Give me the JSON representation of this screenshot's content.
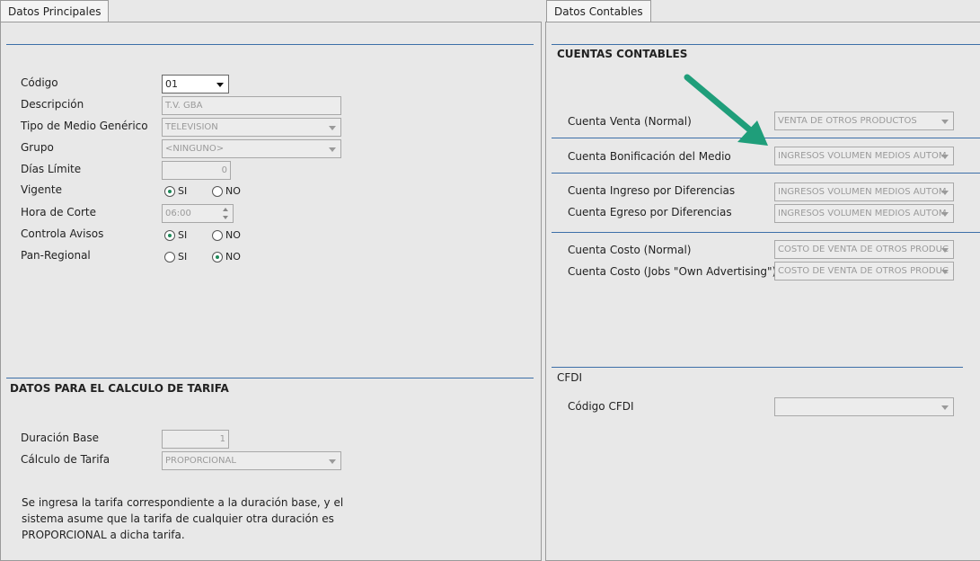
{
  "tabs": {
    "principal": "Datos Principales",
    "contables": "Datos Contables"
  },
  "principal": {
    "codigo": {
      "label": "Código",
      "value": "01"
    },
    "descripcion": {
      "label": "Descripción",
      "value": "T.V. GBA"
    },
    "tipo_medio": {
      "label": "Tipo de Medio Genérico",
      "value": "TELEVISION"
    },
    "grupo": {
      "label": "Grupo",
      "value": "<NINGUNO>"
    },
    "dias_limite": {
      "label": "Días Límite",
      "value": "0"
    },
    "vigente": {
      "label": "Vigente",
      "si": "SI",
      "no": "NO",
      "selected": "SI"
    },
    "hora_corte": {
      "label": "Hora de Corte",
      "value": "06:00"
    },
    "controla_avisos": {
      "label": "Controla Avisos",
      "si": "SI",
      "no": "NO",
      "selected": "SI"
    },
    "pan_regional": {
      "label": "Pan-Regional",
      "si": "SI",
      "no": "NO",
      "selected": "NO"
    }
  },
  "tarifa": {
    "title": "DATOS PARA EL CALCULO DE TARIFA",
    "duracion_base": {
      "label": "Duración Base",
      "value": "1"
    },
    "calculo_tarifa": {
      "label": "Cálculo de Tarifa",
      "value": "PROPORCIONAL"
    },
    "info_line1": "Se ingresa la tarifa correspondiente a la duración base, y el",
    "info_line2": "sistema asume que la tarifa de cualquier otra duración es",
    "info_line3": "PROPORCIONAL a dicha tarifa."
  },
  "contables": {
    "title": "CUENTAS CONTABLES",
    "venta": {
      "label": "Cuenta Venta (Normal)",
      "value": "VENTA DE OTROS PRODUCTOS"
    },
    "bonificacion": {
      "label": "Cuenta Bonificación del Medio",
      "value": "INGRESOS VOLUMEN MEDIOS AUTOM"
    },
    "ingreso_dif": {
      "label": "Cuenta Ingreso por Diferencias",
      "value": "INGRESOS VOLUMEN MEDIOS AUTOM"
    },
    "egreso_dif": {
      "label": "Cuenta Egreso por Diferencias",
      "value": "INGRESOS VOLUMEN MEDIOS AUTOM"
    },
    "costo_normal": {
      "label": "Cuenta Costo (Normal)",
      "value": "COSTO DE VENTA DE OTROS PRODUC"
    },
    "costo_jobs": {
      "label": "Cuenta Costo (Jobs \"Own Advertising\")",
      "value": "COSTO DE VENTA DE OTROS PRODUC"
    }
  },
  "cfdi": {
    "title": "CFDI",
    "codigo": {
      "label": "Código CFDI",
      "value": ""
    }
  },
  "colors": {
    "accent_line": "#3d6fa8",
    "arrow": "#1f9e7a"
  }
}
